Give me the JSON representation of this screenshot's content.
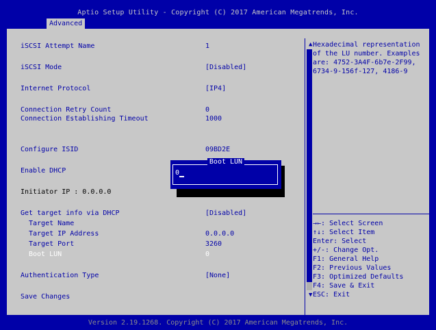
{
  "header": {
    "title": "Aptio Setup Utility - Copyright (C) 2017 American Megatrends, Inc.",
    "tab": "Advanced"
  },
  "settings": [
    {
      "label": "iSCSI Attempt Name",
      "value": "1"
    },
    {
      "label": "iSCSI Mode",
      "value": "[Disabled]"
    },
    {
      "label": "Internet Protocol",
      "value": "[IP4]"
    },
    {
      "label": "Connection Retry Count",
      "value": "0"
    },
    {
      "label": "Connection Establishing Timeout",
      "value": "1000"
    },
    {
      "label": "Configure ISID",
      "value": "09BD2E"
    },
    {
      "label": "Enable DHCP",
      "value": ""
    },
    {
      "label": "Initiator IP : 0.0.0.0",
      "value": ""
    },
    {
      "label": "Get target info via DHCP",
      "value": "[Disabled]"
    },
    {
      "label": "Target Name",
      "value": ""
    },
    {
      "label": "Target IP Address",
      "value": "0.0.0.0"
    },
    {
      "label": "Target Port",
      "value": "3260"
    },
    {
      "label": "Boot LUN",
      "value": "0"
    },
    {
      "label": "Authentication Type",
      "value": "[None]"
    },
    {
      "label": "Save Changes",
      "value": ""
    }
  ],
  "help": {
    "text": "Hexadecimal representation\nof the LU number. Examples\nare: 4752-3A4F-6b7e-2F99,\n6734-9-156f-127, 4186-9"
  },
  "keys": [
    "→←: Select Screen",
    "↑↓: Select Item",
    "Enter: Select",
    "+/-: Change Opt.",
    "F1: General Help",
    "F2: Previous Values",
    "F3: Optimized Defaults",
    "F4: Save & Exit",
    "ESC: Exit"
  ],
  "dialog": {
    "title": "Boot LUN",
    "input_value": "0"
  },
  "scroll": {
    "up": "▲",
    "down": "▼"
  },
  "footer": "Version 2.19.1268. Copyright (C) 2017 American Megatrends, Inc.",
  "colors": {
    "background": "#0000a8",
    "panel": "#c8c8c8",
    "text": "#0000a8",
    "highlight": "#ffffff"
  }
}
